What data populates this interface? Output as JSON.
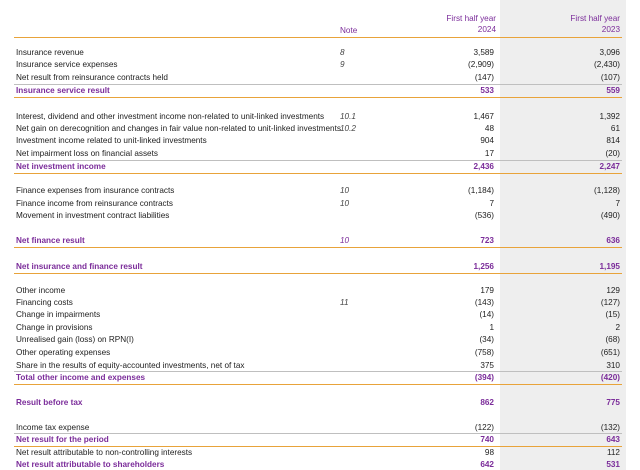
{
  "header": {
    "note": "Note",
    "col1_line1": "First half year",
    "col1_line2": "2024",
    "col2_line1": "First half year",
    "col2_line2": "2023"
  },
  "rows": [
    {
      "label": "Insurance revenue",
      "note": "8",
      "v1": "3,589",
      "v2": "3,096"
    },
    {
      "label": "Insurance service expenses",
      "note": "9",
      "v1": "(2,909)",
      "v2": "(2,430)"
    },
    {
      "label": "Net result from reinsurance contracts held",
      "note": "",
      "v1": "(147)",
      "v2": "(107)"
    },
    {
      "label": "Insurance service result",
      "note": "",
      "v1": "533",
      "v2": "559"
    },
    {
      "label": "Interest, dividend and other investment income non-related to unit-linked investments",
      "note": "10.1",
      "v1": "1,467",
      "v2": "1,392"
    },
    {
      "label": "Net gain on derecognition and changes in fair value non-related to unit-linked investments",
      "note": "10.2",
      "v1": "48",
      "v2": "61"
    },
    {
      "label": "Investment income related to unit-linked investments",
      "note": "",
      "v1": "904",
      "v2": "814"
    },
    {
      "label": "Net impairment loss on financial assets",
      "note": "",
      "v1": "17",
      "v2": "(20)"
    },
    {
      "label": "Net investment income",
      "note": "",
      "v1": "2,436",
      "v2": "2,247"
    },
    {
      "label": "Finance expenses from insurance contracts",
      "note": "10",
      "v1": "(1,184)",
      "v2": "(1,128)"
    },
    {
      "label": "Finance income from reinsurance contracts",
      "note": "10",
      "v1": "7",
      "v2": "7"
    },
    {
      "label": "Movement in investment contract liabilities",
      "note": "",
      "v1": "(536)",
      "v2": "(490)"
    },
    {
      "label": "Net finance result",
      "note": "10",
      "v1": "723",
      "v2": "636"
    },
    {
      "label": "Net insurance and finance result",
      "note": "",
      "v1": "1,256",
      "v2": "1,195"
    },
    {
      "label": "Other income",
      "note": "",
      "v1": "179",
      "v2": "129"
    },
    {
      "label": "Financing costs",
      "note": "11",
      "v1": "(143)",
      "v2": "(127)"
    },
    {
      "label": "Change in impairments",
      "note": "",
      "v1": "(14)",
      "v2": "(15)"
    },
    {
      "label": "Change in provisions",
      "note": "",
      "v1": "1",
      "v2": "2"
    },
    {
      "label": "Unrealised gain (loss) on RPN(I)",
      "note": "",
      "v1": "(34)",
      "v2": "(68)"
    },
    {
      "label": "Other operating expenses",
      "note": "",
      "v1": "(758)",
      "v2": "(651)"
    },
    {
      "label": "Share in the results of equity-accounted investments, net of tax",
      "note": "",
      "v1": "375",
      "v2": "310"
    },
    {
      "label": "Total other income and expenses",
      "note": "",
      "v1": "(394)",
      "v2": "(420)"
    },
    {
      "label": "Result before tax",
      "note": "",
      "v1": "862",
      "v2": "775"
    },
    {
      "label": "Income tax expense",
      "note": "",
      "v1": "(122)",
      "v2": "(132)"
    },
    {
      "label": "Net result for the period",
      "note": "",
      "v1": "740",
      "v2": "643"
    },
    {
      "label": "Net result attributable to non-controlling interests",
      "note": "",
      "v1": "98",
      "v2": "112"
    },
    {
      "label": "Net result attributable to shareholders",
      "note": "",
      "v1": "642",
      "v2": "531"
    }
  ]
}
